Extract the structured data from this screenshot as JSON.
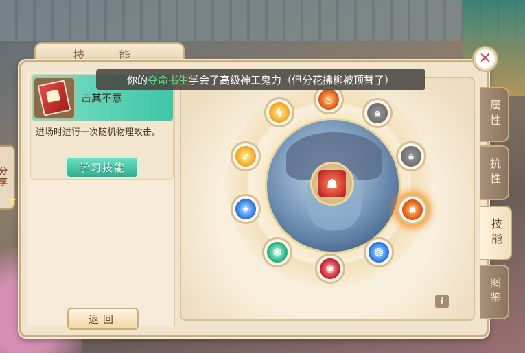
{
  "title": "技 能",
  "notice": {
    "prefix": "你的",
    "pet_name": "夺命书生",
    "suffix": "学会了高级神工鬼力（但分花拂柳被顶替了）"
  },
  "skill": {
    "name": "击其不意",
    "description": "进场时进行一次随机物理攻击。",
    "learn_button": "学习技能",
    "icon": "red-skill-book"
  },
  "back_button": "返回",
  "share_label": "分享",
  "tabs": [
    {
      "label": "属性",
      "active": false
    },
    {
      "label": "抗性",
      "active": false
    },
    {
      "label": "技能",
      "active": true
    },
    {
      "label": "图鉴",
      "active": false
    }
  ],
  "skill_slots": [
    {
      "id": "top",
      "icon": "fire-icon",
      "color": "orange",
      "locked": false
    },
    {
      "id": "top-right",
      "icon": "lock-icon",
      "locked": true
    },
    {
      "id": "right-upper",
      "icon": "lock-icon",
      "locked": true
    },
    {
      "id": "right",
      "icon": "fire-burst-icon",
      "color": "orange",
      "locked": false,
      "active": true
    },
    {
      "id": "bottom-right",
      "icon": "water-swirl-icon",
      "color": "blue",
      "locked": false
    },
    {
      "id": "bottom",
      "icon": "red-vortex-icon",
      "color": "red",
      "locked": false
    },
    {
      "id": "bottom-left",
      "icon": "wind-icon",
      "color": "green",
      "locked": false
    },
    {
      "id": "left",
      "icon": "blue-flame-icon",
      "color": "blue",
      "locked": false
    },
    {
      "id": "left-upper",
      "icon": "golden-slash-icon",
      "color": "yellow",
      "locked": false
    },
    {
      "id": "top-left",
      "icon": "lightning-icon",
      "color": "yellow",
      "locked": false
    }
  ],
  "center_skill": {
    "icon": "demon-mask-icon"
  },
  "info_label": "i"
}
